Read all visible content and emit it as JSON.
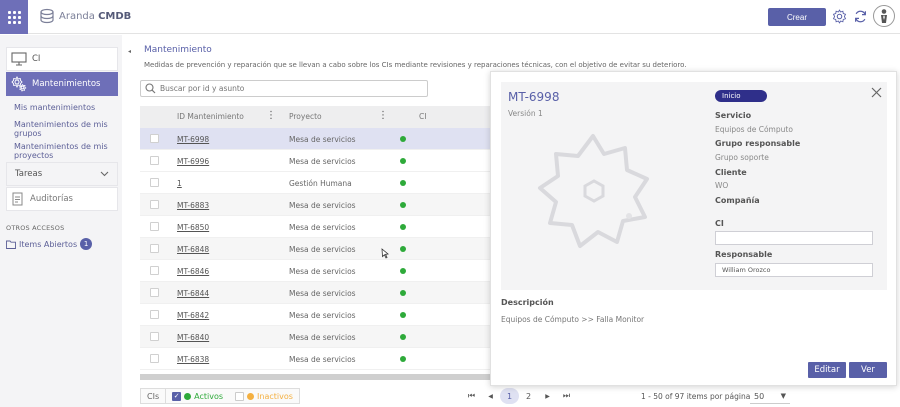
{
  "app": {
    "logo_name": "Aranda",
    "logo_product": "CMDB"
  },
  "topbar": {
    "create_label": "Crear"
  },
  "sidebar": {
    "items": [
      {
        "label": "CI"
      },
      {
        "label": "Mantenimientos"
      },
      {
        "label": "Tareas"
      },
      {
        "label": "Auditorías"
      }
    ],
    "sub_items": [
      {
        "label": "Mis mantenimientos"
      },
      {
        "label": "Mantenimientos de mis grupos"
      },
      {
        "label": "Mantenimientos de mis proyectos"
      }
    ],
    "section_title": "OTROS ACCESOS",
    "open_items": {
      "label": "Items Abiertos",
      "count": "1"
    }
  },
  "main": {
    "title": "Mantenimiento",
    "description": "Medidas de prevención y reparación que se llevan a cabo sobre los CIs mediante revisiones y reparaciones técnicas, con el objetivo de evitar su deterioro.",
    "search_placeholder": "Buscar por id y asunto",
    "columns": {
      "id": "ID Mantenimiento",
      "project": "Proyecto",
      "ci": "CI"
    },
    "rows": [
      {
        "id": "MT-6998",
        "project": "Mesa de servicios"
      },
      {
        "id": "MT-6996",
        "project": "Mesa de servicios"
      },
      {
        "id": "1",
        "project": "Gestión Humana"
      },
      {
        "id": "MT-6883",
        "project": "Mesa de servicios"
      },
      {
        "id": "MT-6850",
        "project": "Mesa de servicios"
      },
      {
        "id": "MT-6848",
        "project": "Mesa de servicios"
      },
      {
        "id": "MT-6846",
        "project": "Mesa de servicios"
      },
      {
        "id": "MT-6844",
        "project": "Mesa de servicios"
      },
      {
        "id": "MT-6842",
        "project": "Mesa de servicios"
      },
      {
        "id": "MT-6840",
        "project": "Mesa de servicios"
      },
      {
        "id": "MT-6838",
        "project": "Mesa de servicios"
      }
    ]
  },
  "footer": {
    "cis_label": "CIs",
    "active_label": "Activos",
    "inactive_label": "Inactivos",
    "pages": [
      "1",
      "2"
    ],
    "range_info": "1 - 50 of 97 items por página",
    "per_page": "50"
  },
  "panel": {
    "title": "MT-6998",
    "version": "Versión 1",
    "status": "Inicio",
    "service_label": "Servicio",
    "service_value": "Equipos de Cómputo",
    "group_label": "Grupo responsable",
    "group_value": "Grupo soporte",
    "client_label": "Cliente",
    "client_value": "WO",
    "company_label": "Compañía",
    "ci_label": "CI",
    "ci_value": "",
    "responsible_label": "Responsable",
    "responsible_value": "William Orozco",
    "description_label": "Descripción",
    "description_value": "Equipos de Cómputo >> Falla Monitor",
    "edit_label": "Editar",
    "view_label": "Ver"
  },
  "colors": {
    "accent": "#5960a8",
    "sidebar_active": "#6e6fb8",
    "status_badge": "#2f2f8a",
    "active_dot": "#2eaa3a",
    "inactive_dot": "#f4b041"
  }
}
